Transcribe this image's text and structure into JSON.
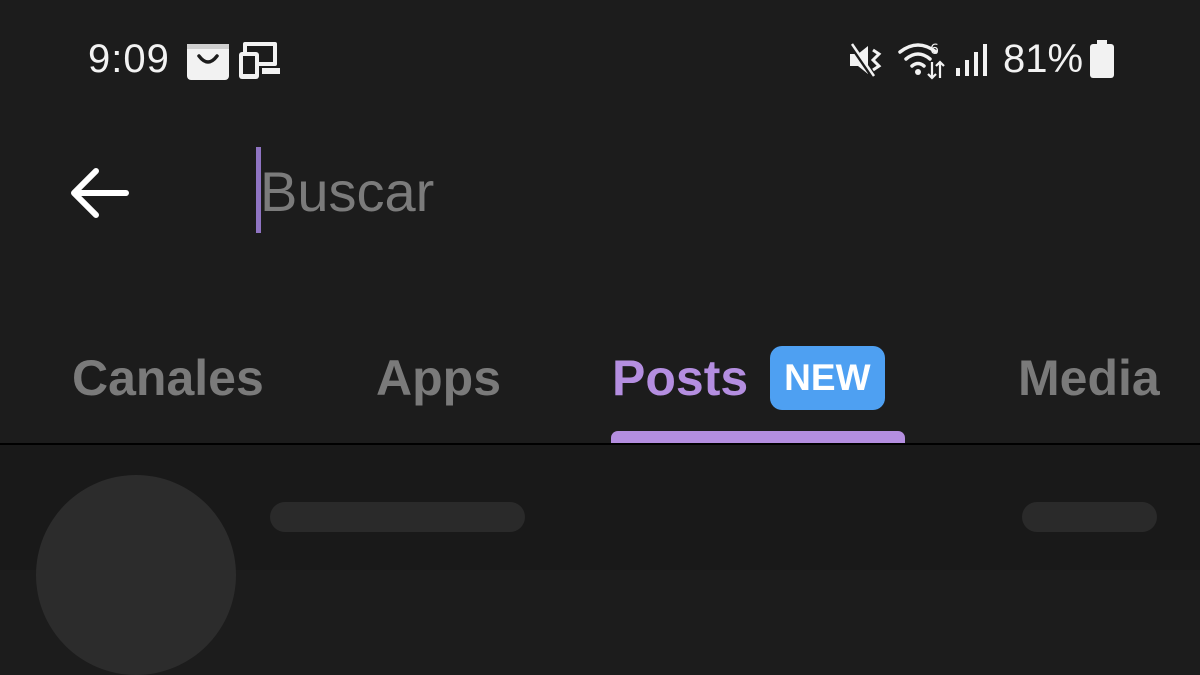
{
  "status_bar": {
    "time": "9:09",
    "battery_percent": "81%",
    "notification_icons": [
      "shopping-bag-icon",
      "phone-link-icon"
    ],
    "system_icons": [
      "mute-vibrate-icon",
      "wifi-6-icon",
      "signal-icon",
      "battery-icon"
    ]
  },
  "search": {
    "placeholder": "Buscar",
    "value": ""
  },
  "tabs": [
    {
      "label": "Canales",
      "active": false
    },
    {
      "label": "Apps",
      "active": false
    },
    {
      "label": "Posts",
      "active": true,
      "badge": "NEW"
    },
    {
      "label": "Media",
      "active": false
    }
  ],
  "colors": {
    "background": "#1c1c1c",
    "accent": "#b48ee0",
    "badge": "#4ea0f2",
    "inactive_tab": "#7a7a7a"
  }
}
